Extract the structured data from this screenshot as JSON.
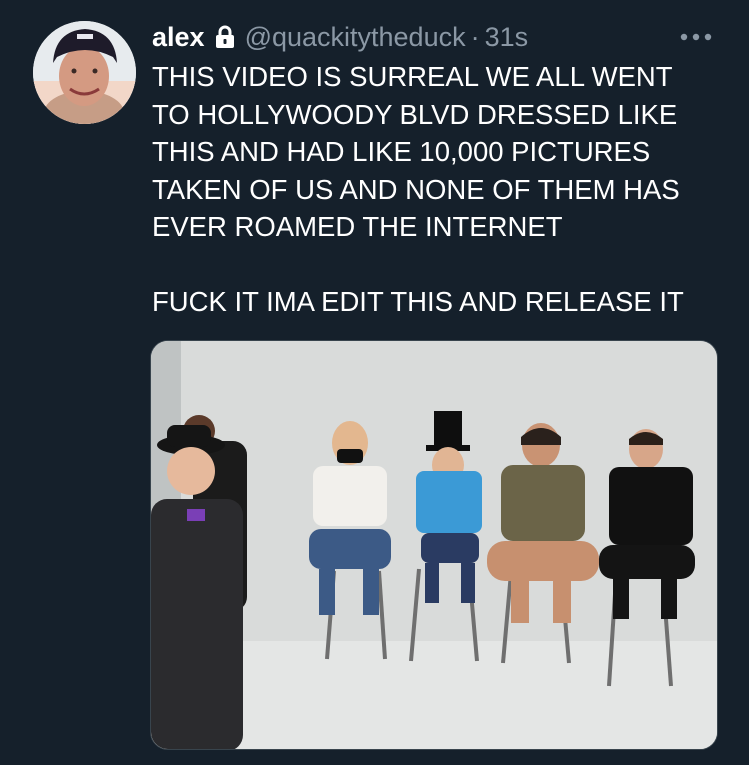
{
  "tweet": {
    "author": {
      "display_name": "alex",
      "handle": "@quackitytheduck",
      "protected_icon": "lock-icon",
      "avatar_icon": "avatar-photo"
    },
    "separator": "·",
    "time": "31s",
    "more_icon": "more-horizontal-icon",
    "text": "THIS VIDEO IS SURREAL WE ALL WENT\nTO HOLLYWOODY BLVD DRESSED LIKE\nTHIS AND HAD LIKE 10,000 PICTURES\nTAKEN OF US AND NONE OF THEM HAS\nEVER ROAMED THE INTERNET\n\nFUCK IT IMA EDIT THIS AND RELEASE IT",
    "media": {
      "kind": "photo"
    }
  },
  "colors": {
    "background": "#15202b",
    "primary_text": "#ffffff",
    "secondary_text": "#8b98a5",
    "border": "#38444d"
  }
}
